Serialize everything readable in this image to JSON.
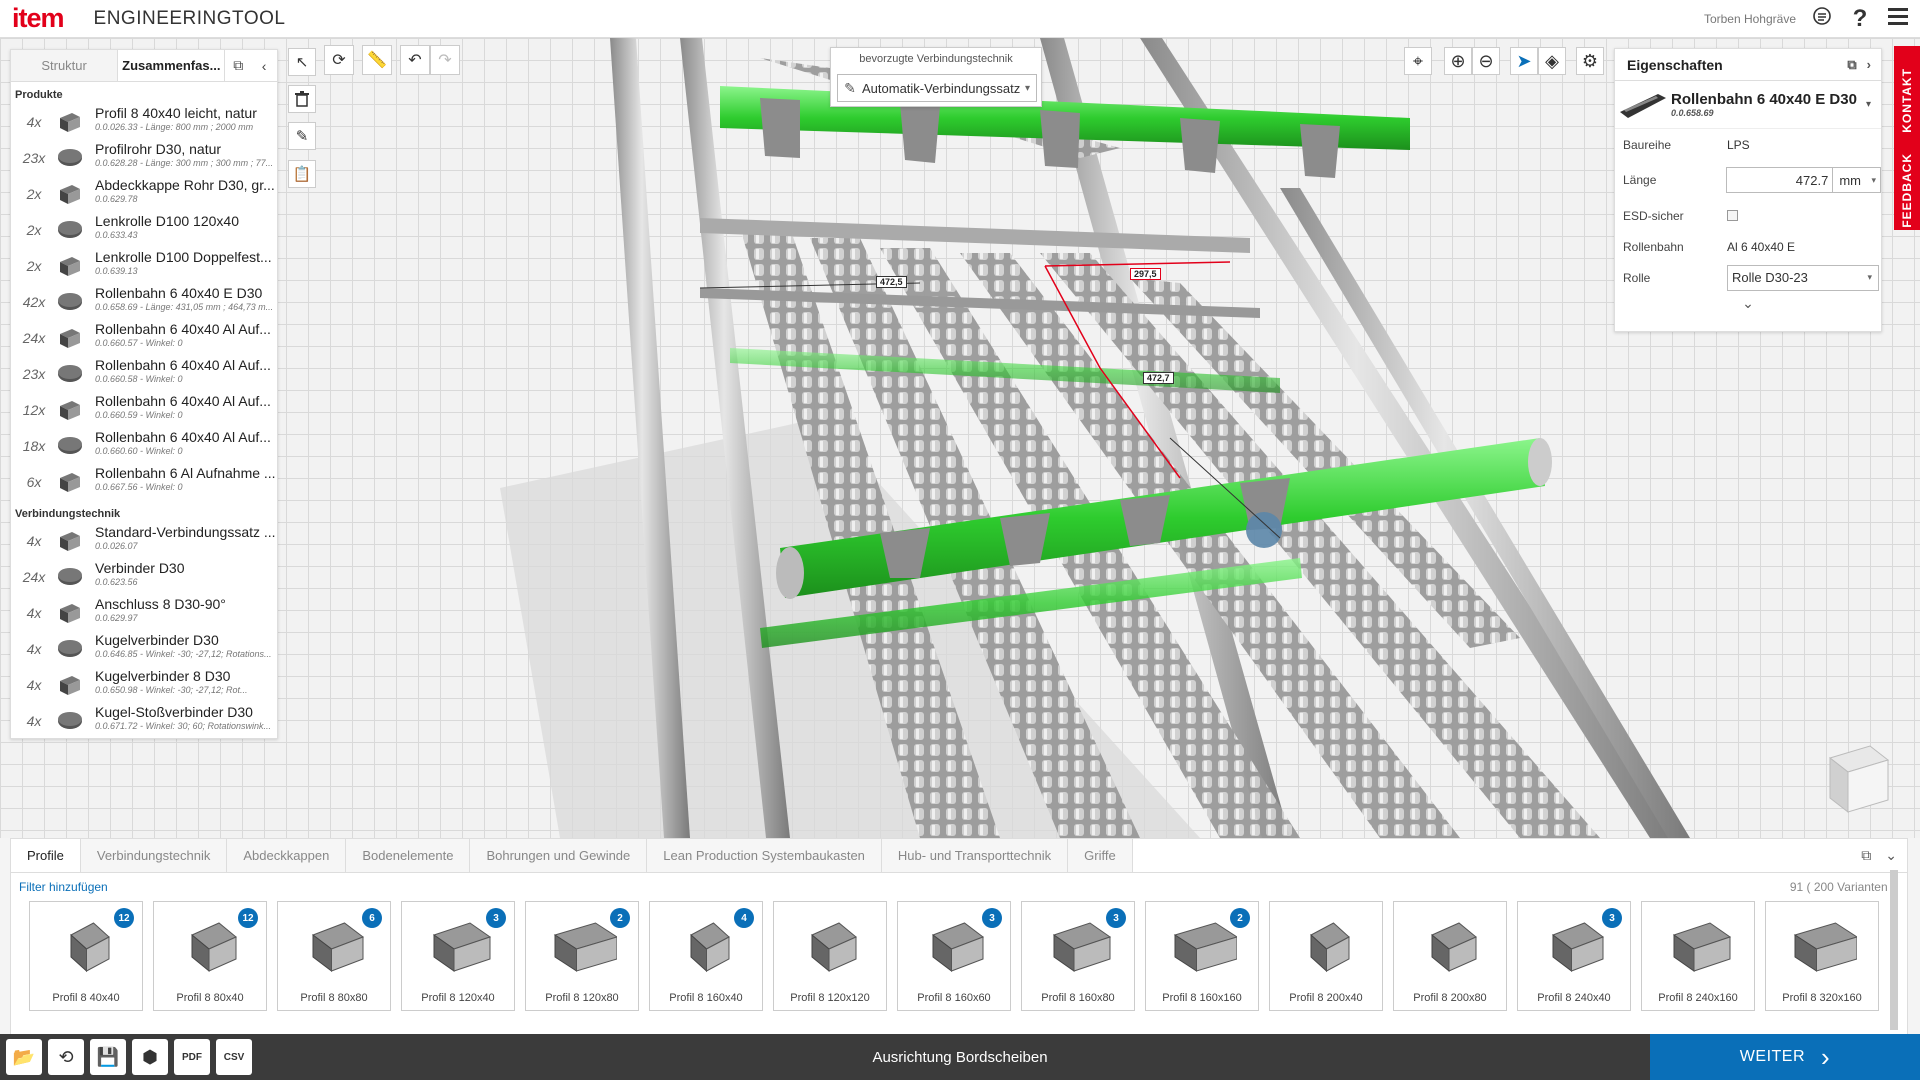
{
  "header": {
    "logo": "item",
    "title": "ENGINEERINGTOOL",
    "user": "Torben Hohgräve",
    "icons": [
      "user-settings-icon",
      "help-icon",
      "menu-icon"
    ]
  },
  "left_panel": {
    "tabs": [
      "Struktur",
      "Zusammenfas..."
    ],
    "sections": {
      "produkte": "Produkte",
      "verbindung": "Verbindungstechnik"
    },
    "products": [
      {
        "qty": "4x",
        "name": "Profil 8 40x40 leicht, natur",
        "sub": "0.0.026.33 - Länge: 800 mm ; 2000 mm"
      },
      {
        "qty": "23x",
        "name": "Profilrohr D30, natur",
        "sub": "0.0.628.28 - Länge: 300 mm ; 300 mm ; 77..."
      },
      {
        "qty": "2x",
        "name": "Abdeckkappe Rohr D30, gr...",
        "sub": "0.0.629.78"
      },
      {
        "qty": "2x",
        "name": "Lenkrolle D100 120x40",
        "sub": "0.0.633.43"
      },
      {
        "qty": "2x",
        "name": "Lenkrolle D100 Doppelfest...",
        "sub": "0.0.639.13"
      },
      {
        "qty": "42x",
        "name": "Rollenbahn 6 40x40 E D30",
        "sub": "0.0.658.69 - Länge: 431,05 mm ; 464,73 m..."
      },
      {
        "qty": "24x",
        "name": "Rollenbahn 6 40x40 Al Auf...",
        "sub": "0.0.660.57 - Winkel: 0"
      },
      {
        "qty": "23x",
        "name": "Rollenbahn 6 40x40 Al Auf...",
        "sub": "0.0.660.58 - Winkel: 0"
      },
      {
        "qty": "12x",
        "name": "Rollenbahn 6 40x40 Al Auf...",
        "sub": "0.0.660.59 - Winkel: 0"
      },
      {
        "qty": "18x",
        "name": "Rollenbahn 6 40x40 Al Auf...",
        "sub": "0.0.660.60 - Winkel: 0"
      },
      {
        "qty": "6x",
        "name": "Rollenbahn 6 Al Aufnahme ...",
        "sub": "0.0.667.56 - Winkel: 0"
      }
    ],
    "connections": [
      {
        "qty": "4x",
        "name": "Standard-Verbindungssatz ...",
        "sub": "0.0.026.07"
      },
      {
        "qty": "24x",
        "name": "Verbinder D30",
        "sub": "0.0.623.56"
      },
      {
        "qty": "4x",
        "name": "Anschluss 8 D30-90°",
        "sub": "0.0.629.97"
      },
      {
        "qty": "4x",
        "name": "Kugelverbinder D30",
        "sub": "0.0.646.85 - Winkel: -30; -27,12; Rotations..."
      },
      {
        "qty": "4x",
        "name": "Kugelverbinder 8 D30",
        "sub": "0.0.650.98 - Winkel: -30; -27,12; Rot..."
      },
      {
        "qty": "4x",
        "name": "Kugel-Stoßverbinder D30",
        "sub": "0.0.671.72 - Winkel: 30; 60; Rotationswink..."
      }
    ]
  },
  "connection_tech": {
    "title": "bevorzugte Verbindungstechnik",
    "value": "Automatik-Verbindungssatz"
  },
  "dimensions": {
    "d1": "472,5",
    "d2": "297,5",
    "d3": "472,7"
  },
  "properties": {
    "title": "Eigenschaften",
    "product_name": "Rollenbahn 6 40x40 E D30",
    "product_number": "0.0.658.69",
    "rows": {
      "baureihe_label": "Baureihe",
      "baureihe_value": "LPS",
      "laenge_label": "Länge",
      "laenge_value": "472.7",
      "laenge_unit": "mm",
      "slider_min": "1",
      "slider_max": "4500",
      "esd_label": "ESD-sicher",
      "rollenbahn_label": "Rollenbahn",
      "rollenbahn_value": "Al 6 40x40 E",
      "rolle_label": "Rolle",
      "rolle_value": "Rolle D30-23"
    }
  },
  "side_tabs": {
    "kontakt": "KONTAKT",
    "feedback": "FEEDBACK"
  },
  "catalog": {
    "tabs": [
      "Profile",
      "Verbindungstechnik",
      "Abdeckkappen",
      "Bodenelemente",
      "Bohrungen und Gewinde",
      "Lean Production Systembaukasten",
      "Hub- und Transporttechnik",
      "Griffe"
    ],
    "filter_label": "Filter hinzufügen",
    "count": "91 ( 200 Varianten )",
    "cards": [
      {
        "label": "Profil 8 40x40",
        "badge": "12"
      },
      {
        "label": "Profil 8 80x40",
        "badge": "12"
      },
      {
        "label": "Profil 8 80x80",
        "badge": "6"
      },
      {
        "label": "Profil 8 120x40",
        "badge": "3"
      },
      {
        "label": "Profil 8 120x80",
        "badge": "2"
      },
      {
        "label": "Profil 8 160x40",
        "badge": "4"
      },
      {
        "label": "Profil 8 120x120",
        "badge": ""
      },
      {
        "label": "Profil 8 160x60",
        "badge": "3"
      },
      {
        "label": "Profil 8 160x80",
        "badge": "3"
      },
      {
        "label": "Profil 8 160x160",
        "badge": "2"
      },
      {
        "label": "Profil 8 200x40",
        "badge": ""
      },
      {
        "label": "Profil 8 200x80",
        "badge": ""
      },
      {
        "label": "Profil 8 240x40",
        "badge": "3"
      },
      {
        "label": "Profil 8 240x160",
        "badge": ""
      },
      {
        "label": "Profil 8 320x160",
        "badge": ""
      }
    ]
  },
  "bottombar": {
    "status": "Ausrichtung Bordscheiben",
    "next": "WEITER",
    "icons": [
      "open-folder-icon",
      "history-icon",
      "save-icon",
      "3d-cube-icon",
      "pdf-icon",
      "csv-icon"
    ]
  },
  "colors": {
    "brand": "#e2001a",
    "accent": "#0a6fb8",
    "highlight": "#33cc33"
  }
}
